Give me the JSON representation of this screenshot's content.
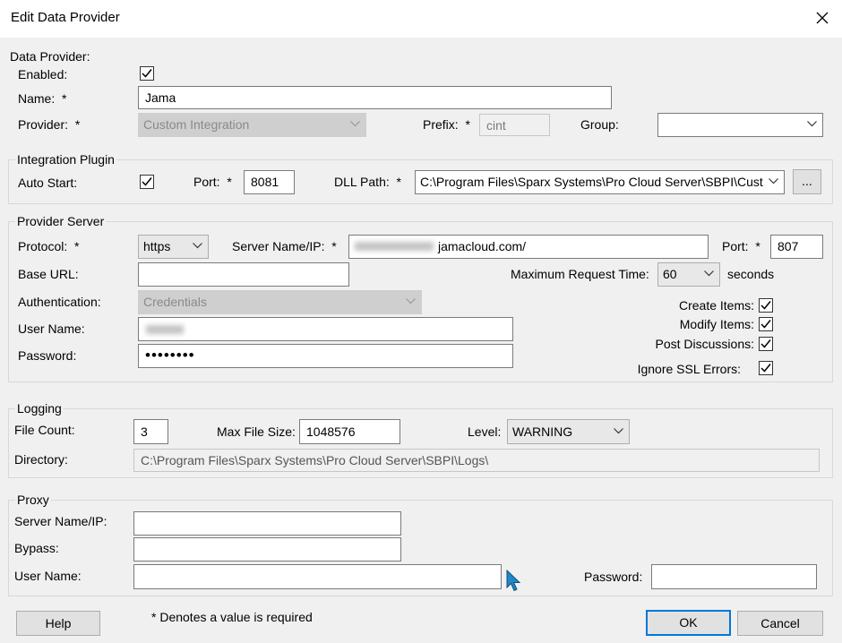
{
  "window": {
    "title": "Edit Data Provider"
  },
  "data_provider": {
    "section_label": "Data Provider:",
    "enabled_label": "Enabled:",
    "enabled": true,
    "name_label": "Name:",
    "name_value": "Jama",
    "provider_label": "Provider:",
    "provider_value": "Custom Integration",
    "prefix_label": "Prefix:",
    "prefix_value": "cint",
    "group_label": "Group:",
    "group_value": ""
  },
  "integration_plugin": {
    "section_label": "Integration Plugin",
    "auto_start_label": "Auto Start:",
    "auto_start": true,
    "port_label": "Port:",
    "port_value": "8081",
    "dll_path_label": "DLL Path:",
    "dll_path_value": "C:\\Program Files\\Sparx Systems\\Pro Cloud Server\\SBPI\\Cust",
    "browse_label": "..."
  },
  "provider_server": {
    "section_label": "Provider Server",
    "protocol_label": "Protocol:",
    "protocol_value": "https",
    "server_label": "Server Name/IP:",
    "server_value": "jamacloud.com/",
    "port_label": "Port:",
    "port_value": "807",
    "base_url_label": "Base URL:",
    "base_url_value": "",
    "max_request_label": "Maximum Request Time:",
    "max_request_value": "60",
    "seconds_label": "seconds",
    "auth_label": "Authentication:",
    "auth_value": "Credentials",
    "username_label": "User Name:",
    "password_label": "Password:",
    "password_value": "••••••••",
    "create_items_label": "Create Items:",
    "create_items": true,
    "modify_items_label": "Modify Items:",
    "modify_items": true,
    "post_discussions_label": "Post Discussions:",
    "post_discussions": true,
    "ignore_ssl_label": "Ignore SSL Errors:",
    "ignore_ssl": true
  },
  "logging": {
    "section_label": "Logging",
    "file_count_label": "File Count:",
    "file_count_value": "3",
    "max_file_size_label": "Max File Size:",
    "max_file_size_value": "1048576",
    "level_label": "Level:",
    "level_value": "WARNING",
    "directory_label": "Directory:",
    "directory_value": "C:\\Program Files\\Sparx Systems\\Pro Cloud Server\\SBPI\\Logs\\"
  },
  "proxy": {
    "section_label": "Proxy",
    "server_label": "Server Name/IP:",
    "bypass_label": "Bypass:",
    "username_label": "User Name:",
    "password_label": "Password:"
  },
  "footer": {
    "help_label": "Help",
    "required_note": "*  Denotes a value is required",
    "ok_label": "OK",
    "cancel_label": "Cancel"
  },
  "required_mark": "*",
  "colors": {
    "accent": "#0078d7",
    "cursor": "#1e88c8"
  }
}
